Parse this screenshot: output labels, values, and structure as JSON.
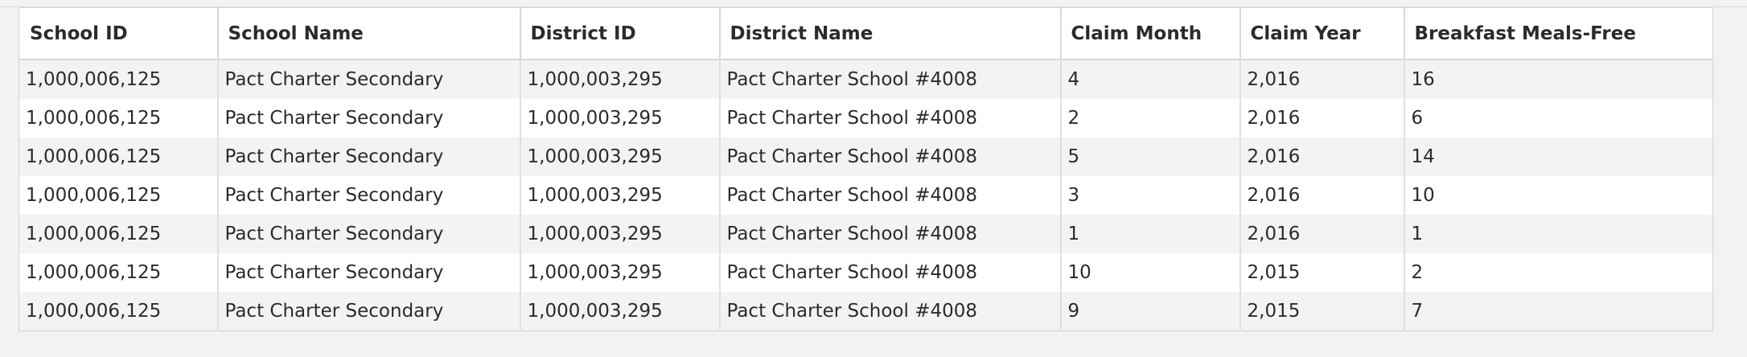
{
  "table": {
    "columns": [
      "School ID",
      "School Name",
      "District ID",
      "District Name",
      "Claim Month",
      "Claim Year",
      "Breakfast Meals-Free"
    ],
    "rows": [
      [
        "1,000,006,125",
        "Pact Charter Secondary",
        "1,000,003,295",
        "Pact Charter School #4008",
        "4",
        "2,016",
        "16"
      ],
      [
        "1,000,006,125",
        "Pact Charter Secondary",
        "1,000,003,295",
        "Pact Charter School #4008",
        "2",
        "2,016",
        "6"
      ],
      [
        "1,000,006,125",
        "Pact Charter Secondary",
        "1,000,003,295",
        "Pact Charter School #4008",
        "5",
        "2,016",
        "14"
      ],
      [
        "1,000,006,125",
        "Pact Charter Secondary",
        "1,000,003,295",
        "Pact Charter School #4008",
        "3",
        "2,016",
        "10"
      ],
      [
        "1,000,006,125",
        "Pact Charter Secondary",
        "1,000,003,295",
        "Pact Charter School #4008",
        "1",
        "2,016",
        "1"
      ],
      [
        "1,000,006,125",
        "Pact Charter Secondary",
        "1,000,003,295",
        "Pact Charter School #4008",
        "10",
        "2,015",
        "2"
      ],
      [
        "1,000,006,125",
        "Pact Charter Secondary",
        "1,000,003,295",
        "Pact Charter School #4008",
        "9",
        "2,015",
        "7"
      ]
    ]
  }
}
